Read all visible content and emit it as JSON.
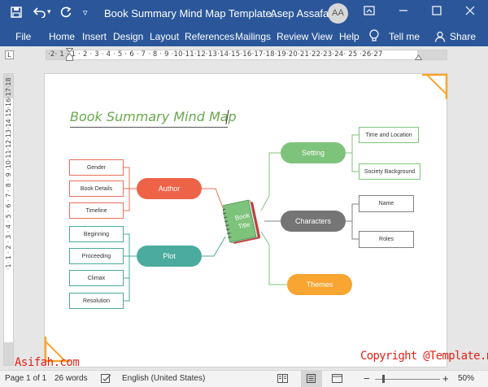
{
  "titlebar": {
    "doc_title": "Book Summary Mind Map Template...",
    "user_name": "Asep Assafah",
    "avatar_initials": "AA",
    "save_icon": "save-icon",
    "undo_icon": "undo-icon",
    "redo_icon": "redo-icon",
    "customize_icon": "customize-qat-icon",
    "ribbon_display_icon": "ribbon-display-icon",
    "minimize_icon": "minimize-icon",
    "maximize_icon": "maximize-icon",
    "close_icon": "close-icon",
    "brand_color": "#2b579a"
  },
  "ribbon": {
    "tabs": [
      "File",
      "Home",
      "Insert",
      "Design",
      "Layout",
      "References",
      "Mailings",
      "Review",
      "View",
      "Help"
    ],
    "tell_me": "Tell me",
    "share": "Share"
  },
  "ruler": {
    "horizontal": "·2· 1 · 1 · 2 · 3 · 4 · 5 · 6 · 7 · 8 · 9 ·10·11·12·13·14·15·16·17·18·19·20·21·22·23·24· 25 ·26·27",
    "vertical": "·1· 1 · 2 · 3 · 4 · 5 · 6 · 7 · 8 · 9 ·10·11·12·13·14·15·16·17·18",
    "tab_selector": "L"
  },
  "document": {
    "title": "Book Summary Mind Map",
    "center": "Book Title",
    "author": {
      "label": "Author",
      "color": "#ee6347",
      "items": [
        "Gender",
        "Book Details",
        "Timeline"
      ]
    },
    "plot": {
      "label": "Plot",
      "color": "#4aab9e",
      "items": [
        "Beginning",
        "Proceeding",
        "Climax",
        "Resolution"
      ]
    },
    "setting": {
      "label": "Setting",
      "color": "#7ec37b",
      "items": [
        "Time and Location",
        "Society Background"
      ]
    },
    "characters": {
      "label": "Characters",
      "color": "#757575",
      "items": [
        "Name",
        "Roles"
      ]
    },
    "themes": {
      "label": "Themes",
      "color": "#f8a531"
    }
  },
  "status": {
    "page": "Page 1 of 1",
    "words": "26 words",
    "language": "English (United States)",
    "zoom": "50%",
    "minus": "−",
    "plus": "+",
    "proof_icon": "proofing-icon",
    "read_mode_icon": "read-mode-icon",
    "print_layout_icon": "print-layout-icon",
    "web_layout_icon": "web-layout-icon"
  },
  "watermarks": {
    "left": "Asifah.com",
    "right": "Copyright @Template.net"
  }
}
